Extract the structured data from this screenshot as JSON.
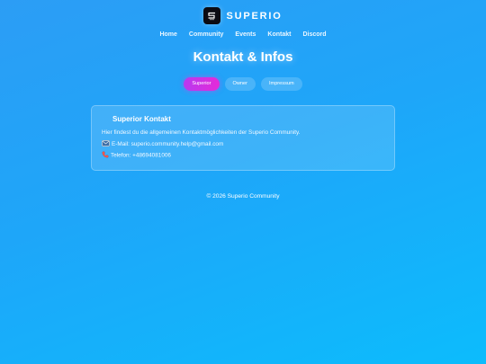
{
  "header": {
    "brand": "SUPERIO",
    "logo_icon": "superio-logo-icon"
  },
  "nav": {
    "items": [
      {
        "label": "Home"
      },
      {
        "label": "Community"
      },
      {
        "label": "Events"
      },
      {
        "label": "Kontakt"
      },
      {
        "label": "Discord"
      }
    ]
  },
  "page": {
    "title": "Kontakt & Infos"
  },
  "tabs": {
    "items": [
      {
        "label": "Superior",
        "active": true
      },
      {
        "label": "Owner",
        "active": false
      },
      {
        "label": "Impressum",
        "active": false
      }
    ]
  },
  "card": {
    "title": "Superior Kontakt",
    "description": "Hier findest du die allgemeinen Kontaktmöglichkeiten der Superio Community.",
    "email": "E-Mail: superio.community.help@gmail.com",
    "phone": "Telefon: +48694081006",
    "email_icon": "email-icon",
    "phone_icon": "phone-icon"
  },
  "footer": {
    "text": "© 2026 Superio Community"
  },
  "colors": {
    "bg_start": "#2c9df5",
    "bg_end": "#0cbcfc",
    "tab_active_start": "#b83af0",
    "tab_active_end": "#e42ad8"
  }
}
